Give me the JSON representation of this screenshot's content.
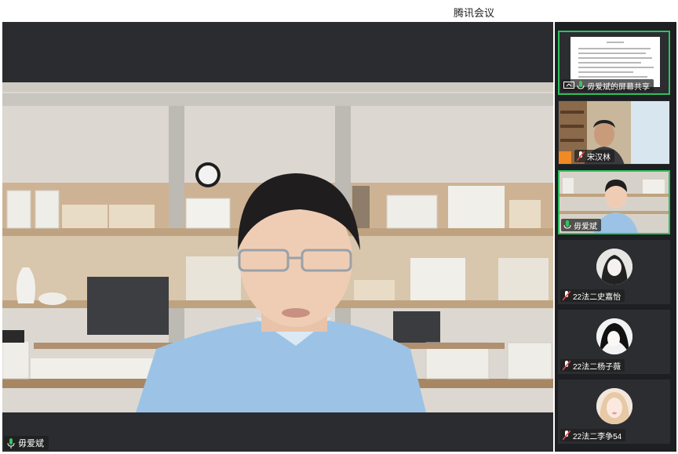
{
  "app": {
    "title": "腾讯会议"
  },
  "main_video": {
    "speaker_name": "毋爱斌",
    "mic": "on"
  },
  "participants": [
    {
      "label": "毋爱斌的屏幕共享",
      "kind": "screen-share",
      "active": true,
      "mic": "on"
    },
    {
      "label": "宋汉林",
      "kind": "video",
      "active": false,
      "mic": "muted"
    },
    {
      "label": "毋爱斌",
      "kind": "video",
      "active": true,
      "mic": "on"
    },
    {
      "label": "22法二史嘉怡",
      "kind": "avatar",
      "active": false,
      "mic": "muted"
    },
    {
      "label": "22法二杨子薇",
      "kind": "avatar",
      "active": false,
      "mic": "muted"
    },
    {
      "label": "22法二李争54",
      "kind": "avatar",
      "active": false,
      "mic": "muted"
    }
  ],
  "colors": {
    "active_border": "#2fbf5f",
    "mic_on": "#35c45b",
    "mic_muted": "#e04a4a",
    "sidebar_bg": "#1e1f22"
  }
}
